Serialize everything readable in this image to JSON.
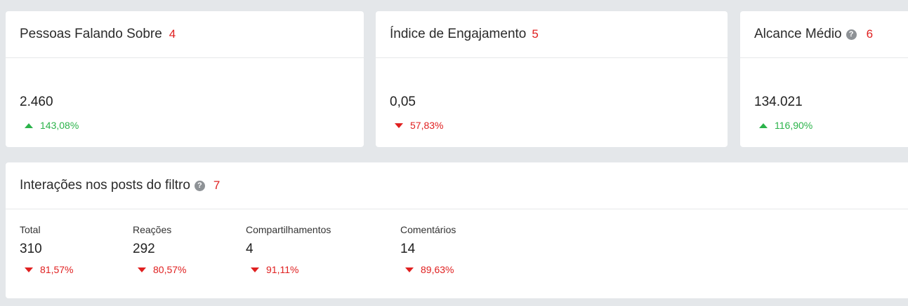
{
  "cards": [
    {
      "title": "Pessoas Falando Sobre",
      "badge": "4",
      "value": "2.460",
      "change": "143,08%",
      "direction": "up"
    },
    {
      "title": "Índice de Engajamento",
      "badge": "5",
      "value": "0,05",
      "change": "57,83%",
      "direction": "down"
    },
    {
      "title": "Alcance Médio",
      "badge": "6",
      "value": "134.021",
      "change": "116,90%",
      "direction": "up"
    }
  ],
  "help_glyph": "?",
  "interactions": {
    "title": "Interações nos posts do filtro",
    "badge": "7",
    "stats": [
      {
        "label": "Total",
        "value": "310",
        "change": "81,57%",
        "direction": "down"
      },
      {
        "label": "Reações",
        "value": "292",
        "change": "80,57%",
        "direction": "down"
      },
      {
        "label": "Compartilhamentos",
        "value": "4",
        "change": "91,11%",
        "direction": "down"
      },
      {
        "label": "Comentários",
        "value": "14",
        "change": "89,63%",
        "direction": "down"
      }
    ]
  },
  "colors": {
    "up": "#2bb34a",
    "down": "#e02020",
    "badge": "#e02020",
    "background": "#e4e7ea"
  }
}
